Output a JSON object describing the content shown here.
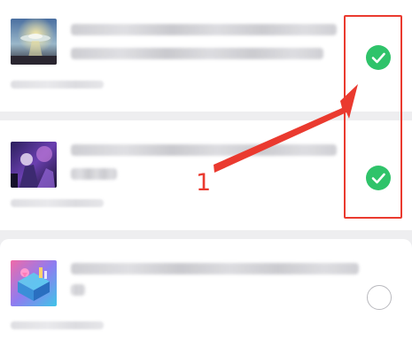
{
  "annotation": {
    "step_label": "1",
    "color": "#ea3a2f"
  },
  "list": {
    "items": [
      {
        "selected": true,
        "thumbnail": "ufo-landscape-thumbnail"
      },
      {
        "selected": true,
        "thumbnail": "purple-figure-thumbnail"
      },
      {
        "selected": false,
        "thumbnail": "isometric-city-thumbnail"
      }
    ],
    "check_color": "#2fc36a",
    "check_icon": "checkmark-icon"
  }
}
